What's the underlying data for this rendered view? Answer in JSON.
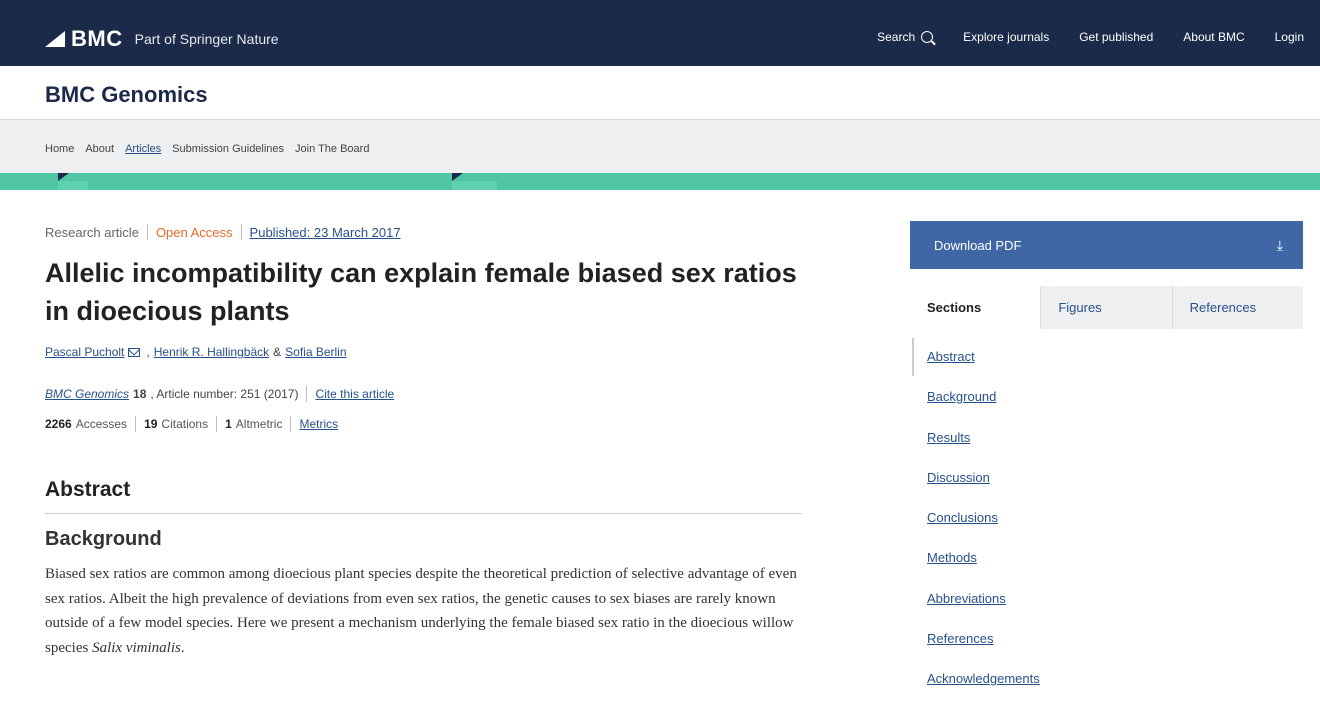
{
  "header": {
    "logo_text": "BMC",
    "logo_sub": "Part of Springer Nature",
    "nav": [
      "Search",
      "Explore journals",
      "Get published",
      "About BMC",
      "Login"
    ]
  },
  "journal": {
    "title": "BMC Genomics"
  },
  "subnav": [
    "Home",
    "About",
    "Articles",
    "Submission Guidelines",
    "Join The Board"
  ],
  "article": {
    "type": "Research article",
    "access": "Open Access",
    "published": "Published: 23 March 2017",
    "title": "Allelic incompatibility can explain female biased sex ratios in dioecious plants",
    "authors": [
      "Pascal Pucholt",
      "Henrik R. Hallingbäck",
      "Sofia Berlin"
    ],
    "author_amp": "&",
    "author_comma": ",",
    "citation": {
      "journal": "BMC Genomics",
      "volume": "18",
      "detail": ", Article number: 251 (2017)",
      "cite_link": "Cite this article"
    },
    "metrics": {
      "accesses": "2266",
      "accesses_label": "Accesses",
      "citations": "19",
      "citations_label": "Citations",
      "altmetric": "1",
      "altmetric_label": "Altmetric",
      "metrics_link": "Metrics"
    }
  },
  "abstract": {
    "heading": "Abstract",
    "subheading": "Background",
    "text": "Biased sex ratios are common among dioecious plant species despite the theoretical prediction of selective advantage of even sex ratios. Albeit the high prevalence of deviations from even sex ratios, the genetic causes to sex biases are rarely known outside of a few model species. Here we present a mechanism underlying the female biased sex ratio in the dioecious willow species",
    "species": "Salix viminalis",
    "period": "."
  },
  "sidebar": {
    "download_label": "Download PDF",
    "download_icon": "⤓",
    "tabs": [
      "Sections",
      "Figures",
      "References"
    ],
    "sections": [
      "Abstract",
      "Background",
      "Results",
      "Discussion",
      "Conclusions",
      "Methods",
      "Abbreviations",
      "References",
      "Acknowledgements"
    ]
  },
  "colors": {
    "header_bg": "#1b2a48",
    "accent_teal": "#50c5a3",
    "download_bg": "#3f67a6",
    "link": "#27518c",
    "open_access": "#e36b2b"
  }
}
